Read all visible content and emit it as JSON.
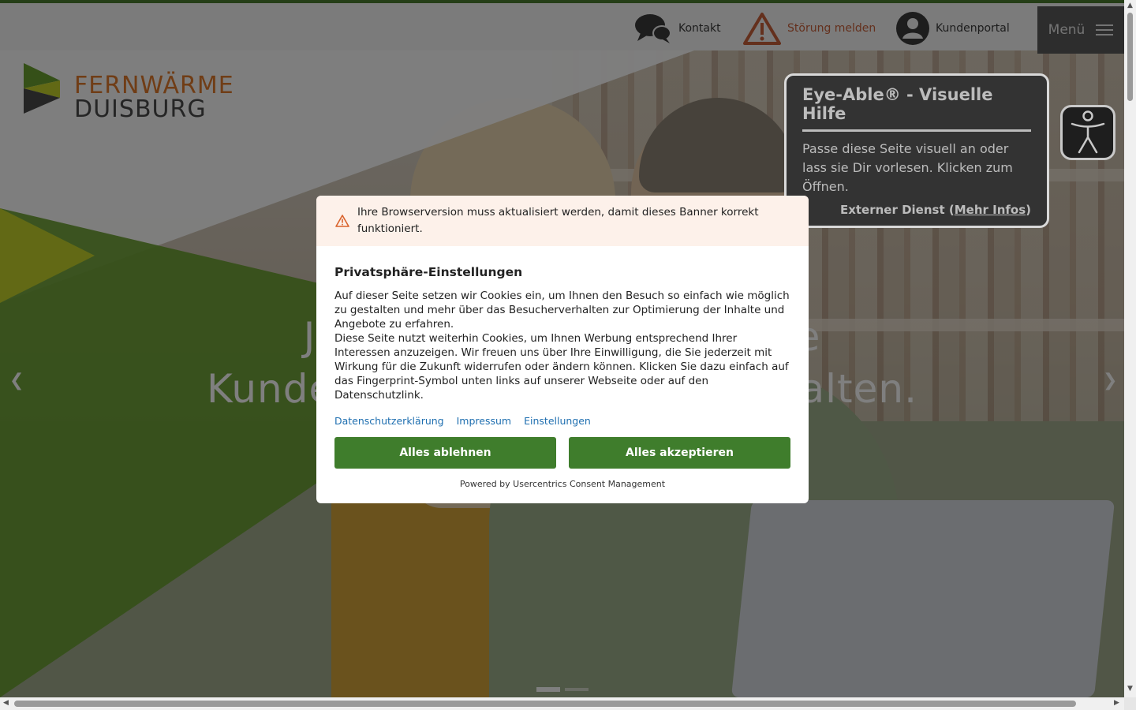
{
  "header": {
    "kontakt_label": "Kontakt",
    "stoerung_label": "Störung melden",
    "portal_label": "Kundenportal",
    "menu_label": "Menü"
  },
  "logo": {
    "line1": "FERNWÄRME",
    "line2": "DUISBURG"
  },
  "hero": {
    "headline_line1": "J                                    e",
    "headline_line2": "Kunde                                   alten.",
    "slides": 2,
    "active_slide": 1
  },
  "eye_able": {
    "title": "Eye-Able® - Visuelle Hilfe",
    "description": "Passe diese Seite visuell an oder lass sie Dir vorlesen. Klicken zum Öffnen.",
    "external_prefix": "Externer Dienst (",
    "external_link": "Mehr Infos",
    "external_suffix": ")"
  },
  "consent": {
    "warning": "Ihre Browserversion muss aktualisiert werden, damit dieses Banner korrekt funktioniert.",
    "title": "Privatsphäre-Einstellungen",
    "paragraph1": "Auf dieser Seite setzen wir Cookies ein, um Ihnen den Besuch so einfach wie möglich zu gestalten und mehr über das Besucherverhalten zur Optimierung der Inhalte und Angebote zu erfahren.",
    "paragraph2": "Diese Seite nutzt weiterhin Cookies, um Ihnen Werbung entsprechend Ihrer Interessen anzuzeigen. Wir freuen uns über Ihre Einwilligung, die Sie jederzeit mit Wirkung für die Zukunft widerrufen oder ändern können. Klicken Sie dazu einfach auf das Fingerprint-Symbol unten links auf unserer Webseite oder auf den Datenschutzlink.",
    "link_privacy": "Datenschutzerklärung",
    "link_imprint": "Impressum",
    "link_settings": "Einstellungen",
    "btn_reject": "Alles ablehnen",
    "btn_accept": "Alles akzeptieren",
    "powered_by": "Powered by Usercentrics Consent Management"
  },
  "colors": {
    "brand_green": "#3f7d2c",
    "brand_orange": "#e07a2c",
    "warning_orange": "#c9613a"
  }
}
